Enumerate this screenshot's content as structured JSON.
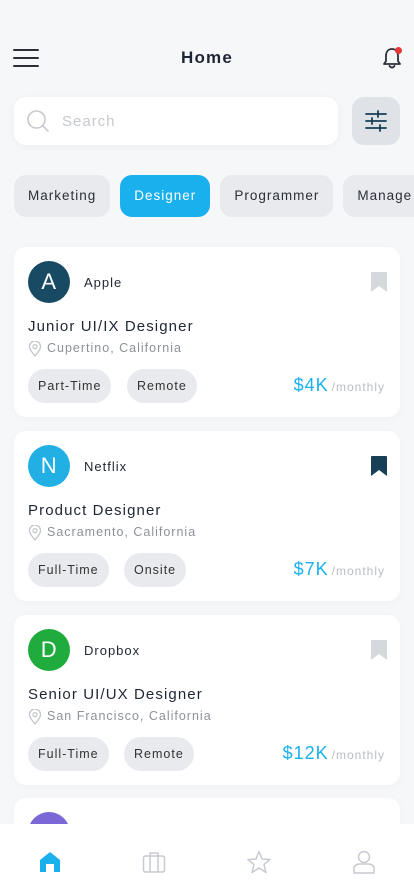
{
  "header": {
    "title": "Home"
  },
  "search": {
    "placeholder": "Search",
    "value": ""
  },
  "categories": [
    {
      "label": "Marketing",
      "active": false
    },
    {
      "label": "Designer",
      "active": true
    },
    {
      "label": "Programmer",
      "active": false
    },
    {
      "label": "Manage",
      "active": false
    }
  ],
  "jobs": [
    {
      "company": "Apple",
      "avatar_letter": "A",
      "avatar_color": "#184a63",
      "bookmarked": false,
      "title": "Junior UI/IX Designer",
      "location": "Cupertino, California",
      "tags": [
        "Part-Time",
        "Remote"
      ],
      "salary": "$4K",
      "period": "/monthly"
    },
    {
      "company": "Netflix",
      "avatar_letter": "N",
      "avatar_color": "#21afe4",
      "bookmarked": true,
      "title": "Product Designer",
      "location": "Sacramento, California",
      "tags": [
        "Full-Time",
        "Onsite"
      ],
      "salary": "$7K",
      "period": "/monthly"
    },
    {
      "company": "Dropbox",
      "avatar_letter": "D",
      "avatar_color": "#1fac3c",
      "bookmarked": false,
      "title": "Senior UI/UX Designer",
      "location": "San Francisco, California",
      "tags": [
        "Full-Time",
        "Remote"
      ],
      "salary": "$12K",
      "period": "/monthly"
    }
  ],
  "colors": {
    "accent": "#1ab0ee",
    "bookmark_active": "#173f56",
    "bookmark_inactive": "#d5d8dc",
    "partial_avatar": "#7b67d6"
  },
  "bottom_nav": [
    {
      "icon": "home-icon",
      "active": true
    },
    {
      "icon": "briefcase-icon",
      "active": false
    },
    {
      "icon": "star-icon",
      "active": false
    },
    {
      "icon": "user-icon",
      "active": false
    }
  ]
}
